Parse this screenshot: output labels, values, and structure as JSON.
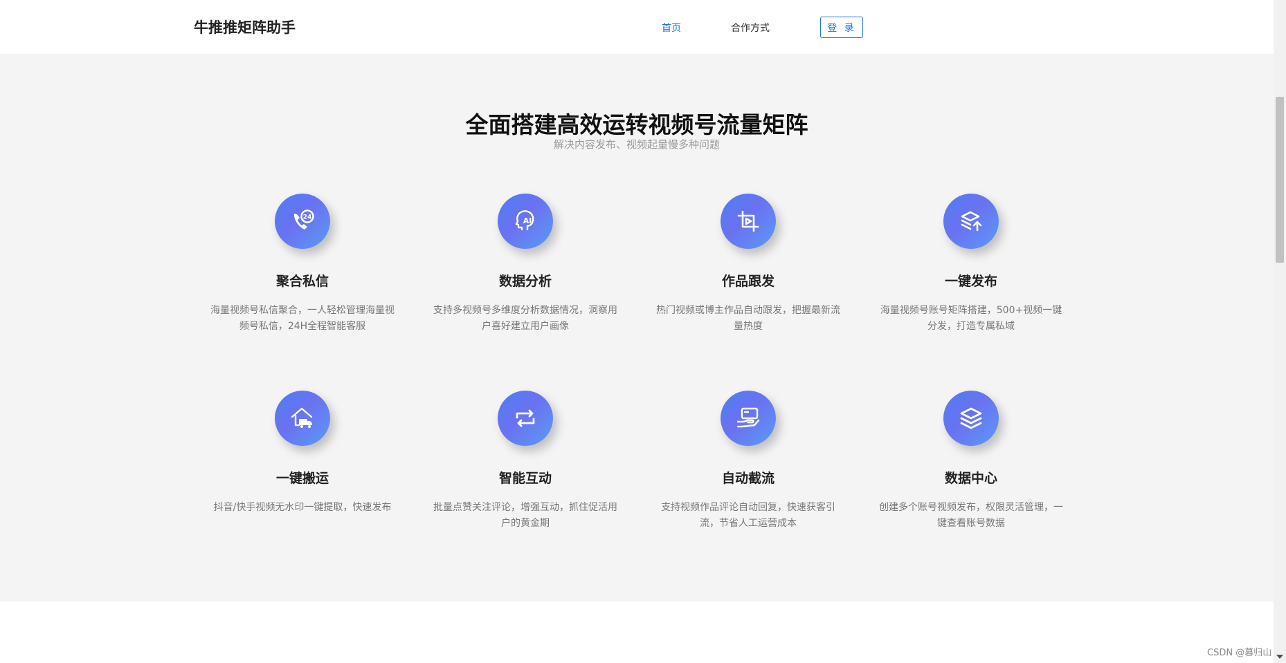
{
  "header": {
    "brand": "牛推推矩阵助手",
    "nav": [
      {
        "label": "首页",
        "active": true
      },
      {
        "label": "合作方式",
        "active": false
      }
    ],
    "login_label": "登 录"
  },
  "main": {
    "title": "全面搭建高效运转视频号流量矩阵",
    "subtitle": "解决内容发布、视频起量慢多种问题",
    "features": [
      {
        "icon": "phone-24-icon",
        "title": "聚合私信",
        "desc": "海量视频号私信聚合，一人轻松管理海量视频号私信，24H全程智能客服"
      },
      {
        "icon": "head-ai-icon",
        "title": "数据分析",
        "desc": "支持多视频号多维度分析数据情况，洞察用户喜好建立用户画像"
      },
      {
        "icon": "crop-play-icon",
        "title": "作品跟发",
        "desc": "热门视频或博主作品自动跟发，把握最新流量热度"
      },
      {
        "icon": "stack-upload-icon",
        "title": "一键发布",
        "desc": "海量视频号账号矩阵搭建，500+视频一键分发，打造专属私域"
      },
      {
        "icon": "house-truck-icon",
        "title": "一键搬运",
        "desc": "抖音/快手视频无水印一键提取，快速发布"
      },
      {
        "icon": "repeat-arrows-icon",
        "title": "智能互动",
        "desc": "批量点赞关注评论，增强互动，抓住促活用户的黄金期"
      },
      {
        "icon": "hand-card-icon",
        "title": "自动截流",
        "desc": "支持视频作品评论自动回复，快速获客引流，节省人工运营成本"
      },
      {
        "icon": "layers-icon",
        "title": "数据中心",
        "desc": "创建多个账号视频发布，权限灵活管理，一键查看账号数据"
      }
    ]
  },
  "watermark": "CSDN @暮归山",
  "colors": {
    "accent": "#1a73e8",
    "icon_gradient_start": "#4f7df5",
    "icon_gradient_end": "#5b9af7",
    "section_bg": "#f4f4f4"
  }
}
